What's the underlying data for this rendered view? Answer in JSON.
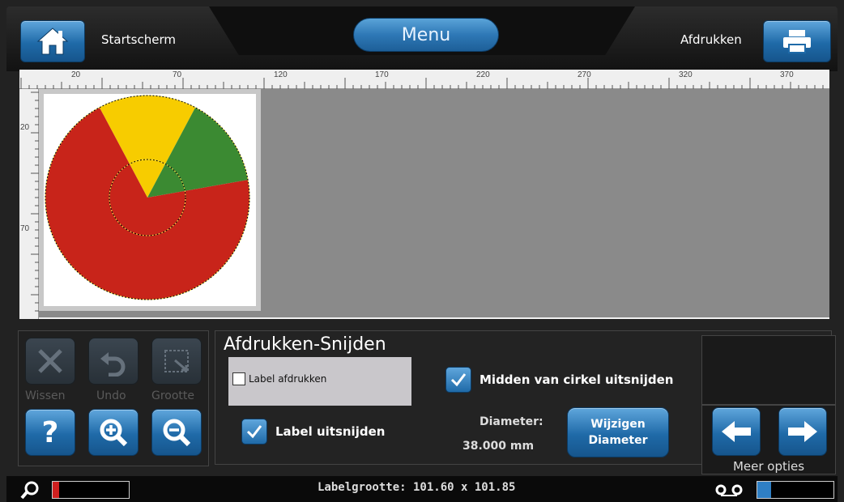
{
  "topbar": {
    "home_label": "Startscherm",
    "menu_label": "Menu",
    "print_label": "Afdrukken"
  },
  "ruler": {
    "horizontal_marks": [
      "20",
      "70",
      "120",
      "170",
      "220",
      "270",
      "320",
      "370"
    ],
    "vertical_marks": [
      "20",
      "70"
    ]
  },
  "label_graphic": {
    "type": "pie",
    "colors": {
      "red": "#c8241a",
      "yellow": "#f7cc00",
      "green": "#3b8a32"
    }
  },
  "tools": {
    "delete_label": "Wissen",
    "undo_label": "Undo",
    "size_label": "Grootte",
    "help_glyph": "?"
  },
  "dialog": {
    "title": "Afdrukken-Snijden",
    "print_label_text": "Label afdrukken",
    "print_label_checked": false,
    "cut_label_text": "Label uitsnijden",
    "cut_label_checked": true,
    "cut_center_text": "Midden van cirkel uitsnijden",
    "cut_center_checked": true,
    "diameter_label": "Diameter:",
    "diameter_value": "38.000  mm",
    "change_diameter_line1": "Wijzigen",
    "change_diameter_line2": "Diameter"
  },
  "more_options": {
    "label": "Meer opties"
  },
  "status": {
    "label_size": "Labelgrootte: 101.60 x 101.85",
    "left_meter_color": "#d02020",
    "right_meter_color": "#2f7fc4"
  }
}
